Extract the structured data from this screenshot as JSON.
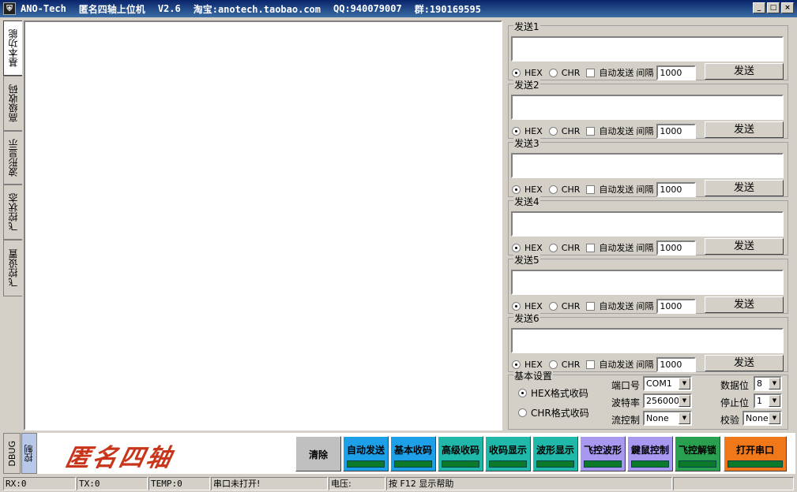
{
  "titlebar": {
    "logo_icon": "shield-icon",
    "app": "ANO-Tech",
    "name": "匿名四轴上位机",
    "version": "V2.6",
    "taobao": "淘宝:anotech.taobao.com",
    "qq": "QQ:940079007",
    "group": "群:190169595",
    "minimize": "_",
    "maximize": "□",
    "close": "×"
  },
  "left_tabs": [
    "基本功能",
    "高级收码",
    "波形显示",
    "飞控状态",
    "飞控设置"
  ],
  "send_groups": [
    {
      "title": "发送1",
      "hex": "HEX",
      "chr": "CHR",
      "auto": "自动发送",
      "interval_label": "间隔",
      "interval": "1000",
      "send": "发送"
    },
    {
      "title": "发送2",
      "hex": "HEX",
      "chr": "CHR",
      "auto": "自动发送",
      "interval_label": "间隔",
      "interval": "1000",
      "send": "发送"
    },
    {
      "title": "发送3",
      "hex": "HEX",
      "chr": "CHR",
      "auto": "自动发送",
      "interval_label": "间隔",
      "interval": "1000",
      "send": "发送"
    },
    {
      "title": "发送4",
      "hex": "HEX",
      "chr": "CHR",
      "auto": "自动发送",
      "interval_label": "间隔",
      "interval": "1000",
      "send": "发送"
    },
    {
      "title": "发送5",
      "hex": "HEX",
      "chr": "CHR",
      "auto": "自动发送",
      "interval_label": "间隔",
      "interval": "1000",
      "send": "发送"
    },
    {
      "title": "发送6",
      "hex": "HEX",
      "chr": "CHR",
      "auto": "自动发送",
      "interval_label": "间隔",
      "interval": "1000",
      "send": "发送"
    }
  ],
  "basic_settings": {
    "title": "基本设置",
    "hex_mode": "HEX格式收码",
    "chr_mode": "CHR格式收码",
    "port_label": "端口号",
    "port": "COM1",
    "baud_label": "波特率",
    "baud": "256000",
    "flow_label": "流控制",
    "flow": "None",
    "databits_label": "数据位",
    "databits": "8",
    "stopbits_label": "停止位",
    "stopbits": "1",
    "parity_label": "校验",
    "parity": "None"
  },
  "bottom": {
    "debug_tab": "DBUG",
    "control_tab": "控制",
    "brand": "匿名四轴",
    "buttons": [
      {
        "label": "清除",
        "color": "#c0c0c0"
      },
      {
        "label": "自动发送",
        "color": "#1ea0e8"
      },
      {
        "label": "基本收码",
        "color": "#1ea0e8"
      },
      {
        "label": "高级收码",
        "color": "#20b8a8"
      },
      {
        "label": "收码显示",
        "color": "#20b8a8"
      },
      {
        "label": "波形显示",
        "color": "#20b8a8"
      },
      {
        "label": "飞控波形",
        "color": "#a898f0"
      },
      {
        "label": "鍵鼠控制",
        "color": "#a898f0"
      },
      {
        "label": "飞控解锁",
        "color": "#28a050"
      },
      {
        "label": "打开串口",
        "color": "#f07818"
      }
    ]
  },
  "status": {
    "rx": "RX:0",
    "tx": "TX:0",
    "temp": "TEMP:0",
    "port_state": "串口未打开!",
    "voltage": "电压:",
    "help": "按 F12 显示帮助"
  }
}
